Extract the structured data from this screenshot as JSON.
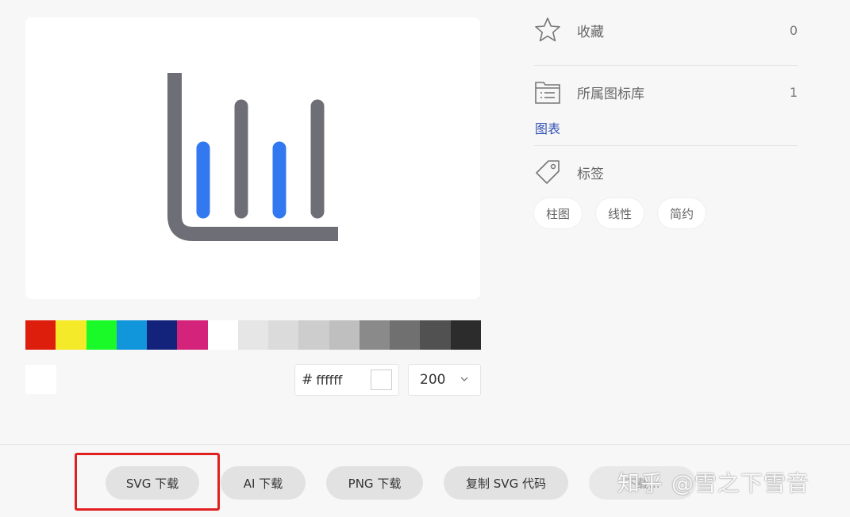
{
  "preview": {
    "icon": "bar-chart-icon",
    "axis_color": "#6e6e76",
    "accent_color": "#3278f0"
  },
  "palette": [
    "#dd1e0c",
    "#f4ea2a",
    "#1afa29",
    "#1296db",
    "#13227a",
    "#d4237a",
    "#ffffff",
    "#e6e6e6",
    "#dbdbdb",
    "#cdcdcd",
    "#bfbfbf",
    "#8a8a8a",
    "#707070",
    "#515151",
    "#2c2c2c"
  ],
  "color_picker": {
    "hash": "#",
    "hex_value": "ffffff",
    "current_color": "#ffffff"
  },
  "size_select": {
    "value": "200"
  },
  "meta": {
    "favorite": {
      "icon": "star-icon",
      "label": "收藏",
      "count": "0"
    },
    "library": {
      "icon": "folder-list-icon",
      "label": "所属图标库",
      "count": "1",
      "link": "图表"
    },
    "tags": {
      "icon": "tag-icon",
      "label": "标签",
      "items": [
        "柱图",
        "线性",
        "简约"
      ]
    }
  },
  "actions": {
    "svg_download": "SVG 下载",
    "ai_download": "AI 下载",
    "png_download": "PNG 下载",
    "copy_svg": "复制 SVG 代码",
    "more": "下载..."
  },
  "watermark": "知乎 @雪之下雪音"
}
